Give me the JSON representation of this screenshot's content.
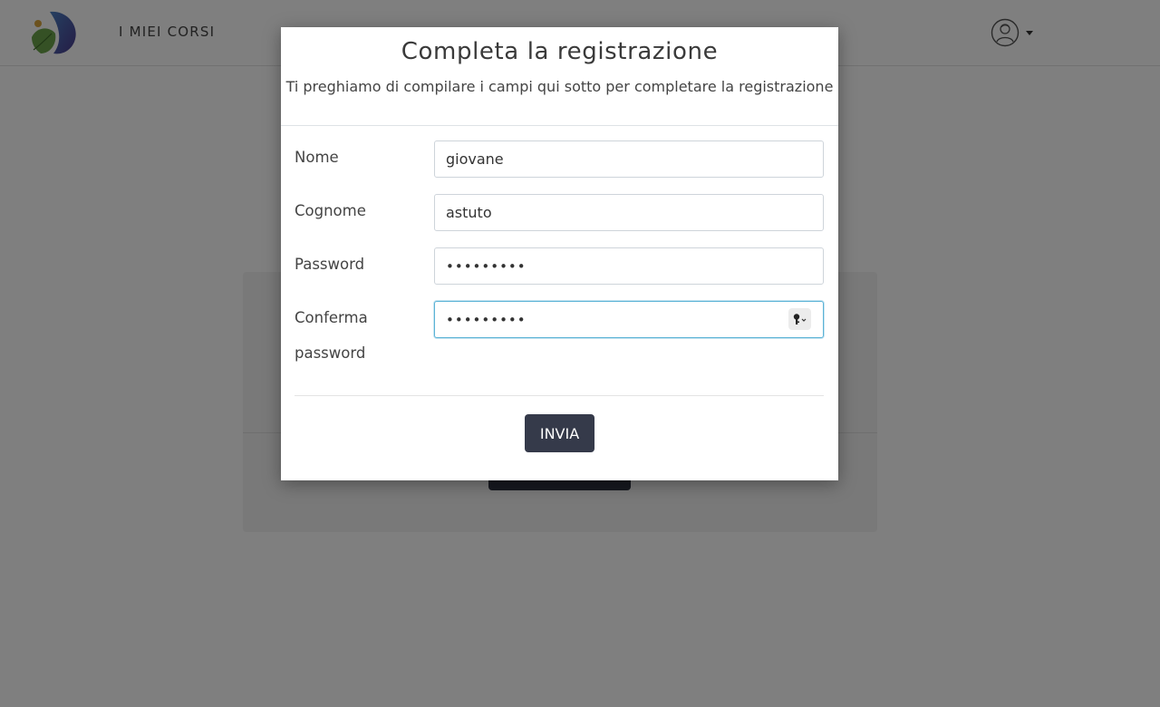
{
  "header": {
    "nav_link": "I MIEI CORSI",
    "logo_icon": "leaf-logo-icon",
    "avatar_icon": "user-avatar-icon",
    "caret_icon": "caret-down-icon"
  },
  "modal": {
    "title": "Completa la registrazione",
    "subtitle": "Ti preghiamo di compilare i campi qui sotto per completare la registrazione",
    "fields": [
      {
        "label": "Nome",
        "value": "giovane",
        "type": "text"
      },
      {
        "label": "Cognome",
        "value": "astuto",
        "type": "text"
      },
      {
        "label": "Password",
        "value": "•••••••••",
        "type": "password"
      },
      {
        "label": "Conferma password",
        "value": "•••••••••",
        "type": "password"
      }
    ],
    "submit_label": "INVIA",
    "key_icon": "password-key-icon"
  },
  "colors": {
    "overlay": "rgba(0,0,0,0.5)",
    "button": "#353a4a",
    "focus_border": "#5cb3d6"
  }
}
